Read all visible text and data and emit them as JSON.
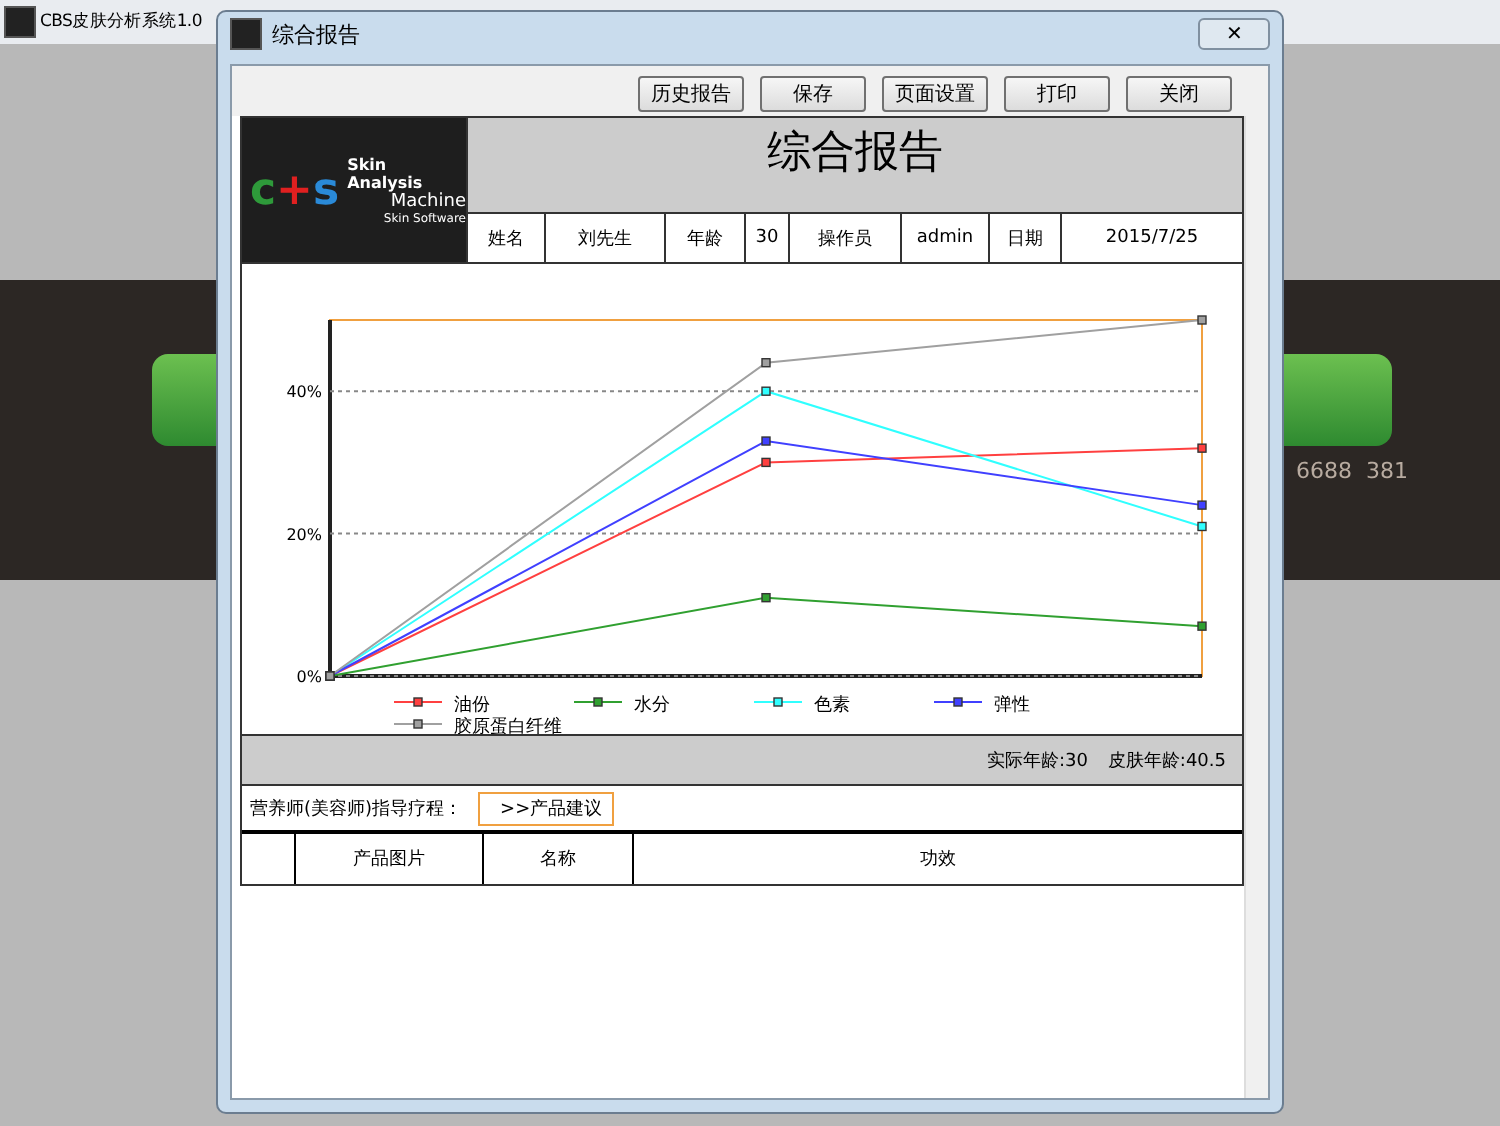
{
  "app_window": {
    "title": "CBS皮肤分析系统1.0",
    "phone": "6688  381"
  },
  "dialog": {
    "title": "综合报告",
    "close": "✕"
  },
  "toolbar": [
    "历史报告",
    "保存",
    "页面设置",
    "打印",
    "关闭"
  ],
  "report": {
    "logo": {
      "letters": [
        {
          "char": "c",
          "color": "#2e9a3a"
        },
        {
          "char": "+",
          "color": "#e02020"
        },
        {
          "char": "s",
          "color": "#2a8ad8"
        }
      ],
      "brand": "Skin Analysis",
      "subtitle": "Machine",
      "tagline": "Skin Software"
    },
    "title": "综合报告",
    "info": [
      {
        "label": "姓名",
        "value": "刘先生"
      },
      {
        "label": "年龄",
        "value": "30"
      },
      {
        "label": "操作员",
        "value": "admin"
      },
      {
        "label": "日期",
        "value": "2015/7/25"
      }
    ],
    "chart_data": {
      "type": "line",
      "legend": "bottom",
      "ylim": [
        0,
        50
      ],
      "yticks": [
        {
          "value": 0,
          "label": "0%"
        },
        {
          "value": 20,
          "label": "20%"
        },
        {
          "value": 40,
          "label": "40%"
        }
      ],
      "series": [
        {
          "name": "油份",
          "color": "#ff4040",
          "marker": "square",
          "values": [
            0,
            30,
            32
          ]
        },
        {
          "name": "水分",
          "color": "#30a030",
          "marker": "square",
          "values": [
            0,
            11,
            7
          ]
        },
        {
          "name": "色素",
          "color": "#30ffff",
          "marker": "square",
          "values": [
            0,
            40,
            21
          ]
        },
        {
          "name": "弹性",
          "color": "#4040ff",
          "marker": "square",
          "values": [
            0,
            33,
            24
          ]
        },
        {
          "name": "胶原蛋白纤维",
          "color": "#a0a0a0",
          "marker": "square",
          "values": [
            0,
            44,
            50
          ]
        }
      ]
    },
    "ages": [
      "实际年龄:30",
      "皮肤年龄:40.5"
    ],
    "guide": {
      "label": "营养师(美容师)指导疗程：",
      "link": ">>产品建议"
    },
    "table": {
      "columns": [
        "产品图片",
        "名称",
        "功效"
      ]
    }
  }
}
